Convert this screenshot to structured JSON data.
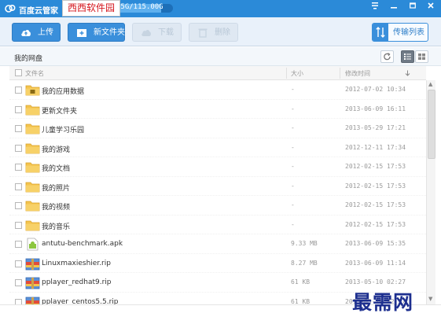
{
  "window": {
    "title": "百度云管家",
    "quota_text": "95G/115.00G",
    "quota_fraction": 0.83
  },
  "watermark_top": "西西软件园",
  "watermark_bottom": "最需网",
  "toolbar": {
    "upload": "上传",
    "new_folder": "新文件夹",
    "download": "下载",
    "delete": "删除",
    "transfer_list": "传输列表"
  },
  "path": "我的网盘",
  "headers": {
    "name": "文件名",
    "size": "大小",
    "modified": "修改时间"
  },
  "files": [
    {
      "name": "我的应用数据",
      "size": "-",
      "date": "2012-07-02 10:34",
      "icon": "app-folder-icon"
    },
    {
      "name": "更新文件夹",
      "size": "-",
      "date": "2013-06-09 16:11",
      "icon": "folder-icon"
    },
    {
      "name": "儿童学习乐园",
      "size": "-",
      "date": "2013-05-29 17:21",
      "icon": "folder-icon"
    },
    {
      "name": "我的游戏",
      "size": "-",
      "date": "2012-12-11 17:34",
      "icon": "folder-icon"
    },
    {
      "name": "我的文档",
      "size": "-",
      "date": "2012-02-15 17:53",
      "icon": "folder-icon"
    },
    {
      "name": "我的照片",
      "size": "-",
      "date": "2012-02-15 17:53",
      "icon": "folder-icon"
    },
    {
      "name": "我的视频",
      "size": "-",
      "date": "2012-02-15 17:53",
      "icon": "folder-icon"
    },
    {
      "name": "我的音乐",
      "size": "-",
      "date": "2012-02-15 17:53",
      "icon": "folder-icon"
    },
    {
      "name": "antutu-benchmark.apk",
      "size": "9.33 MB",
      "date": "2013-06-09 15:35",
      "icon": "apk-file-icon"
    },
    {
      "name": "Linuxmaxieshier.rip",
      "size": "8.27 MB",
      "date": "2013-06-09 11:14",
      "icon": "archive-file-icon"
    },
    {
      "name": "pplayer_redhat9.rip",
      "size": "61 KB",
      "date": "2013-05-10 02:27",
      "icon": "archive-file-icon"
    },
    {
      "name": "pplayer_centos5.5.rip",
      "size": "61 KB",
      "date": "2013-05-10 02:27",
      "icon": "archive-file-icon"
    }
  ],
  "colors": {
    "titlebar": "#2b8ad8",
    "accent": "#3a8fdb",
    "folder": "#f4c44e"
  }
}
